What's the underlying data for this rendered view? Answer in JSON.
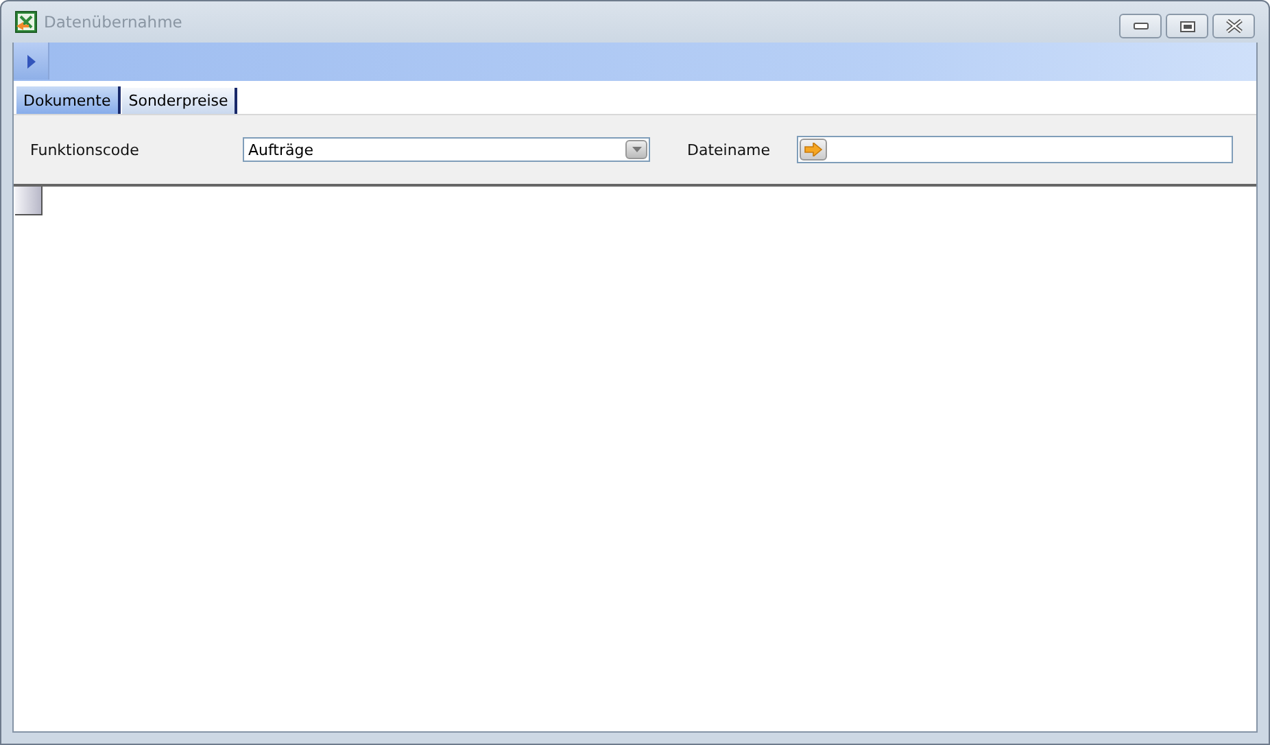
{
  "window": {
    "title": "Datenübernahme"
  },
  "tabs": [
    {
      "label": "Dokumente",
      "selected": true
    },
    {
      "label": "Sonderpreise",
      "selected": false
    }
  ],
  "form": {
    "function_code": {
      "label": "Funktionscode",
      "value": "Aufträge"
    },
    "file_name": {
      "label": "Dateiname"
    }
  }
}
